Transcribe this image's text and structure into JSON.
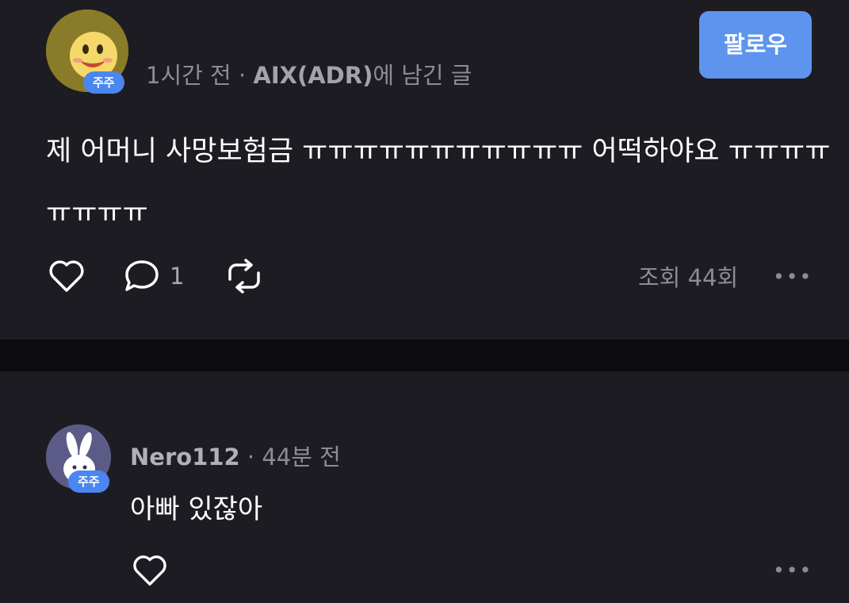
{
  "post": {
    "badge": "주주",
    "time": "1시간 전",
    "separator": "·",
    "stock": "AIX(ADR)",
    "suffix": "에 남긴 글",
    "follow_label": "팔로우",
    "body": "제 어머니 사망보험금 ㅠㅠㅠㅠㅠㅠㅠㅠㅠㅠㅠ 어떡하야요 ㅠㅠㅠㅠㅠㅠㅠㅠ",
    "comment_count": "1",
    "views": "조회 44회",
    "more_label": "•••"
  },
  "comment": {
    "badge": "주주",
    "author": "Nero112",
    "separator": "·",
    "time": "44분 전",
    "body": "아빠 있잖아",
    "more_label": "•••"
  },
  "colors": {
    "card_background": "#1d1c22",
    "page_background": "#000000",
    "accent_blue": "#5e94ee",
    "badge_blue": "#4a86f0",
    "muted_text": "#8c8c95"
  },
  "icons": {
    "post_avatar": "smiley-face-icon",
    "comment_avatar": "rabbit-icon",
    "like": "heart-icon",
    "comment": "speech-bubble-icon",
    "repost": "repost-arrows-icon",
    "more": "more-dots-icon"
  }
}
